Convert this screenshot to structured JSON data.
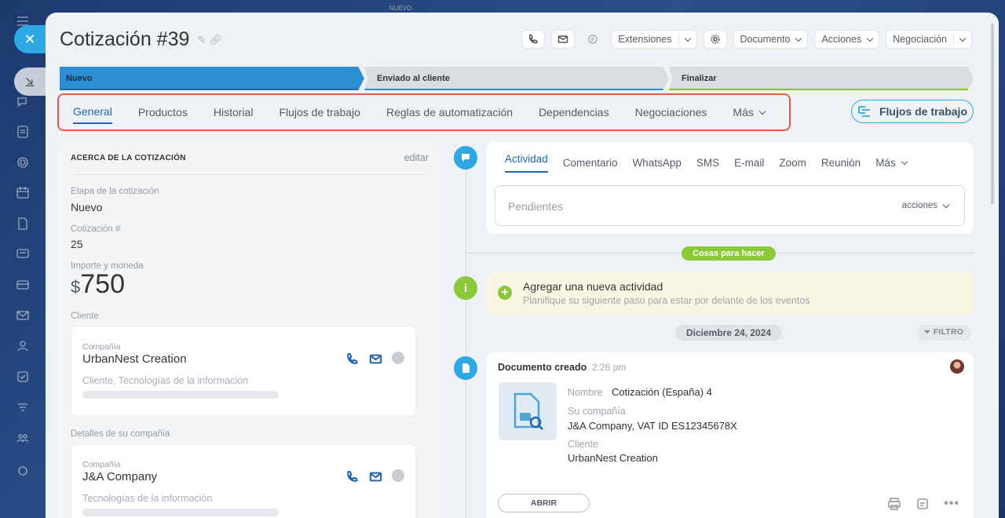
{
  "window": {
    "title": "Cotización #39",
    "top_badge": "NUEVO"
  },
  "toolbar": {
    "extensions_label": "Extensiones",
    "document_label": "Documento",
    "actions_label": "Acciones",
    "deal_label": "Negociación"
  },
  "stages": [
    {
      "label": "Nuevo"
    },
    {
      "label": "Enviado al cliente"
    },
    {
      "label": "Finalizar"
    }
  ],
  "tabs": [
    {
      "label": "General"
    },
    {
      "label": "Productos"
    },
    {
      "label": "Historial"
    },
    {
      "label": "Flujos de trabajo"
    },
    {
      "label": "Reglas de automatización"
    },
    {
      "label": "Dependencias"
    },
    {
      "label": "Negociaciones"
    },
    {
      "label": "Más"
    }
  ],
  "workflows_button": "Flujos de trabajo",
  "about": {
    "heading": "ACERCA DE LA COTIZACIÓN",
    "edit": "editar",
    "stage_label": "Etapa de la cotización",
    "stage_value": "Nuevo",
    "number_label": "Cotización #",
    "number_value": "25",
    "amount_label": "Importe y moneda",
    "currency_symbol": "$",
    "amount_value": "750",
    "client_label": "Cliente",
    "client_card": {
      "type_label": "Compañía",
      "name": "UrbanNest Creation",
      "description": "Cliente, Tecnologías de la información"
    },
    "my_company_label": "Detalles de su compañía",
    "my_company_card": {
      "type_label": "Compañía",
      "name": "J&A Company",
      "description": "Tecnologías de la información"
    }
  },
  "activity": {
    "tabs": [
      {
        "label": "Actividad"
      },
      {
        "label": "Comentario"
      },
      {
        "label": "WhatsApp"
      },
      {
        "label": "SMS"
      },
      {
        "label": "E-mail"
      },
      {
        "label": "Zoom"
      },
      {
        "label": "Reunión"
      },
      {
        "label": "Más"
      }
    ],
    "input_placeholder": "Pendientes",
    "input_actions": "acciones"
  },
  "todo_pill": "Cosas para hacer",
  "new_activity": {
    "title": "Agregar una nueva actividad",
    "subtitle": "Planifique su siguiente paso para estar por delante de los eventos"
  },
  "date_pill": "Diciembre 24, 2024",
  "filter_pill": "FILTRO",
  "document_event": {
    "title": "Documento creado",
    "time": "2:26 pm",
    "name_label": "Nombre",
    "name_value": "Cotización (España) 4",
    "company_label": "Su compañía",
    "company_value": "J&A Company, VAT ID ES12345678X",
    "client_label": "Cliente",
    "client_value": "UrbanNest Creation",
    "open_button": "ABRIR"
  },
  "colors": {
    "accent": "#2066b0",
    "stage_active": "#2d8fd2",
    "green": "#8bc83a",
    "highlight_border": "#e55a4e"
  }
}
